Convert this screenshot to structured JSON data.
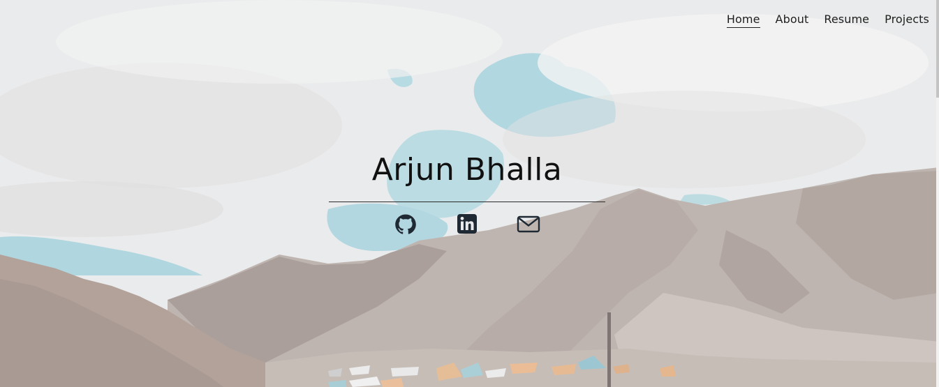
{
  "nav": {
    "items": [
      {
        "label": "Home",
        "active": true
      },
      {
        "label": "About",
        "active": false
      },
      {
        "label": "Resume",
        "active": false
      },
      {
        "label": "Projects",
        "active": false
      }
    ]
  },
  "hero": {
    "name": "Arjun Bhalla"
  },
  "social": {
    "icons": [
      "github-icon",
      "linkedin-icon",
      "mail-icon"
    ]
  },
  "colors": {
    "text": "#111111",
    "sky": "#a9d3dc",
    "overlay": "#ffffff"
  }
}
